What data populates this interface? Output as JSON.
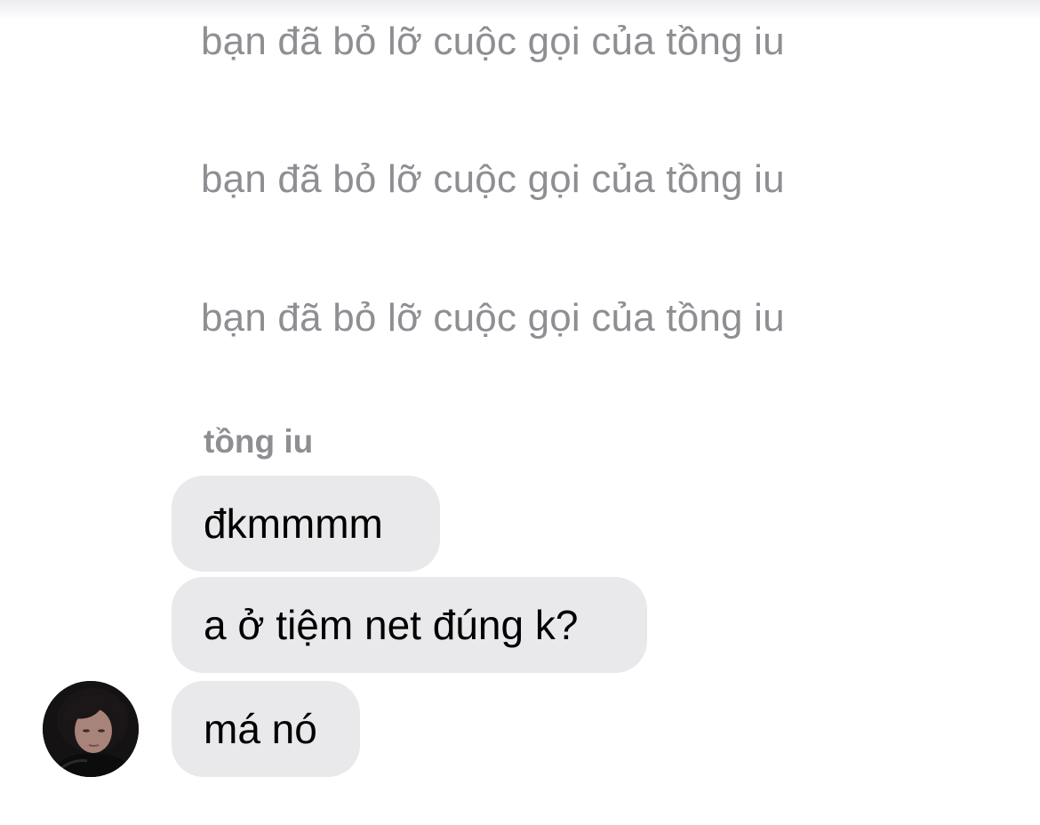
{
  "conversation": {
    "missed_calls": [
      "bạn đã bỏ lỡ cuộc gọi của tồng iu",
      "bạn đã bỏ lỡ cuộc gọi của tồng iu",
      "bạn đã bỏ lỡ cuộc gọi của tồng iu"
    ],
    "sender_name": "tồng iu",
    "messages": [
      "đkmmmm",
      "a ở tiệm net đúng k?",
      "má nó"
    ],
    "avatar_icon": "contact-avatar-photo",
    "colors": {
      "background": "#ffffff",
      "bubble": "#e9e9eb",
      "secondary_text": "#8e8e93",
      "message_text": "#000000"
    }
  }
}
